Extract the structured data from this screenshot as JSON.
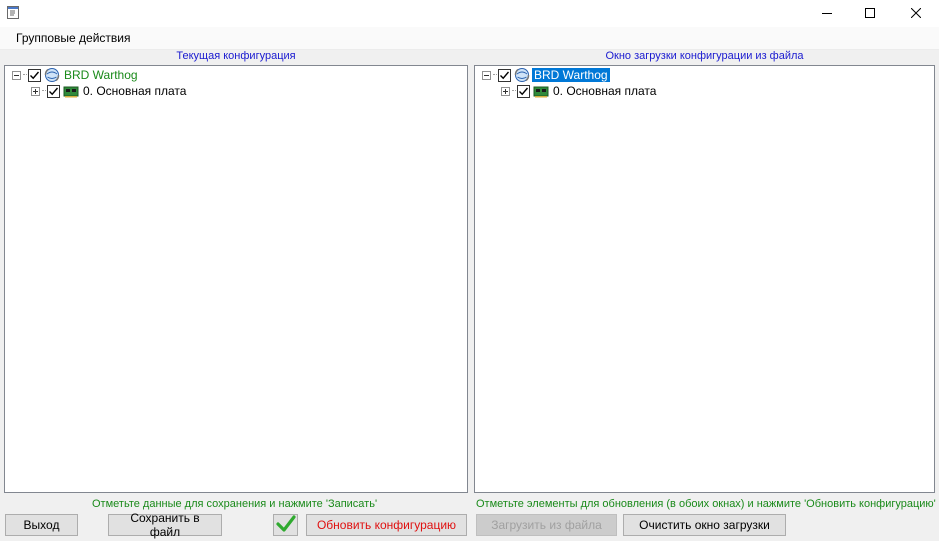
{
  "window": {
    "icon": "form-window-icon",
    "controls": [
      "minimize-icon",
      "maximize-icon",
      "close-icon"
    ]
  },
  "menu": {
    "group_actions": "Групповые действия"
  },
  "left_panel": {
    "caption": "Текущая конфигурация",
    "nodes": [
      {
        "label": "BRD Warthog",
        "checked": true,
        "expanded": true,
        "icon": "device-globe-icon",
        "style": "green"
      },
      {
        "label": "0. Основная плата",
        "checked": true,
        "expanded": false,
        "icon": "board-icon",
        "style": "normal"
      }
    ],
    "hint": "Отметьте данные для сохранения и нажмите 'Записать'"
  },
  "right_panel": {
    "caption": "Окно загрузки конфигурации из файла",
    "nodes": [
      {
        "label": "BRD Warthog",
        "checked": true,
        "expanded": true,
        "icon": "device-globe-icon",
        "style": "selected"
      },
      {
        "label": "0. Основная плата",
        "checked": true,
        "expanded": false,
        "icon": "board-icon",
        "style": "normal"
      }
    ],
    "hint": "Отметьте элементы для обновления (в обоих окнах) и нажмите 'Обновить конфигурацию'"
  },
  "buttons": {
    "exit": "Выход",
    "save_to_file": "Сохранить в файл",
    "apply_icon": "green-check-icon",
    "update_config": "Обновить конфигурацию",
    "load_from_file": "Загрузить из файла",
    "clear_load_window": "Очистить окно загрузки"
  },
  "colors": {
    "caption_blue": "#1a1ad0",
    "hint_green": "#1a8a1a",
    "update_red": "#e01010",
    "selection_blue": "#0078d7",
    "disabled_gray": "#a0a0a0"
  }
}
